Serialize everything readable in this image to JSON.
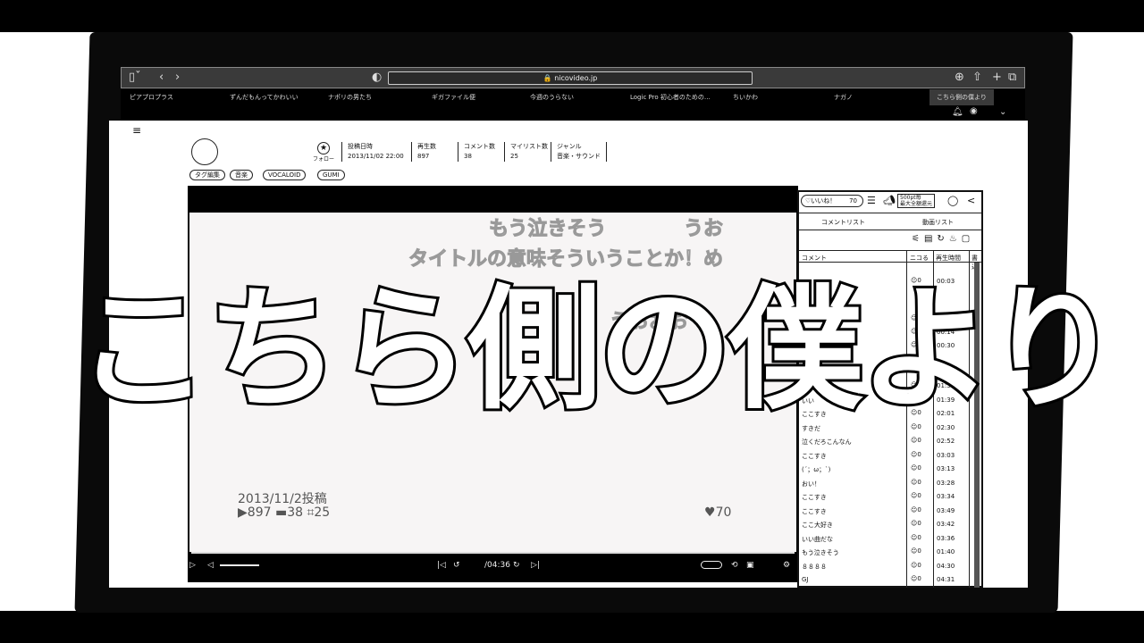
{
  "browser": {
    "url": "nicovideo.jp",
    "bookmarks": [
      "ピアプロプラス",
      "ずんだもんってかわいい",
      "ナポリの男たち",
      "ギガファイル便",
      "今週のうらない",
      "Logic Pro 初心者のための…",
      "ちいかわ",
      "ナガノ",
      "こちら側の僕より"
    ]
  },
  "video_meta": {
    "follow_label": "フォロー",
    "stats": [
      {
        "label": "投稿日時",
        "value": "2013/11/02 22:00"
      },
      {
        "label": "再生数",
        "value": "897"
      },
      {
        "label": "コメント数",
        "value": "38"
      },
      {
        "label": "マイリスト数",
        "value": "25"
      },
      {
        "label": "ジャンル",
        "value": "音楽・サウンド"
      }
    ],
    "tag_edit": "タグ編集",
    "tags": [
      "音楽",
      "VOCALOID",
      "GUMI"
    ]
  },
  "player": {
    "danmaku": [
      "もう泣きそう",
      "うお",
      "タイトルの意味そういうことか！め",
      "うおおお"
    ],
    "posted": "2013/11/2投稿",
    "views": "897",
    "comments": "38",
    "mylists": "25",
    "likes": "70",
    "duration": "/04:36"
  },
  "side": {
    "like_label": "いいね！",
    "like_count": "70",
    "ad_label": "500pt毎\n最大全額還元",
    "tabs": [
      "コメントリスト",
      "動画リスト"
    ],
    "headers": [
      "コメント",
      "ニコる",
      "再生時間",
      "書込"
    ],
    "comments": [
      {
        "text": "",
        "nicoru": "0",
        "time": "00:03"
      },
      {
        "text": "",
        "nicoru": "0",
        "time": "00:13"
      },
      {
        "text": "",
        "nicoru": "0",
        "time": "00:14"
      },
      {
        "text": "",
        "nicoru": "0",
        "time": "00:30"
      },
      {
        "text": "うわこれ",
        "nicoru": "0",
        "time": "01:33"
      },
      {
        "text": "いい",
        "nicoru": "0",
        "time": "01:39"
      },
      {
        "text": "ここすき",
        "nicoru": "0",
        "time": "02:01"
      },
      {
        "text": "すきだ",
        "nicoru": "0",
        "time": "02:30"
      },
      {
        "text": "泣くだろこんなん",
        "nicoru": "0",
        "time": "02:52"
      },
      {
        "text": "ここすき",
        "nicoru": "0",
        "time": "03:03"
      },
      {
        "text": "(´；ω；`)",
        "nicoru": "0",
        "time": "03:13"
      },
      {
        "text": "おい！",
        "nicoru": "0",
        "time": "03:28"
      },
      {
        "text": "ここすき",
        "nicoru": "0",
        "time": "03:34"
      },
      {
        "text": "ここすき",
        "nicoru": "0",
        "time": "03:49"
      },
      {
        "text": "ここ大好き",
        "nicoru": "0",
        "time": "03:42"
      },
      {
        "text": "いい曲だな",
        "nicoru": "0",
        "time": "03:36"
      },
      {
        "text": "もう泣きそう",
        "nicoru": "0",
        "time": "01:40"
      },
      {
        "text": "８８８８",
        "nicoru": "0",
        "time": "04:30"
      },
      {
        "text": "GJ",
        "nicoru": "0",
        "time": "04:31"
      }
    ]
  },
  "overlay_title": "こちら側の僕より"
}
